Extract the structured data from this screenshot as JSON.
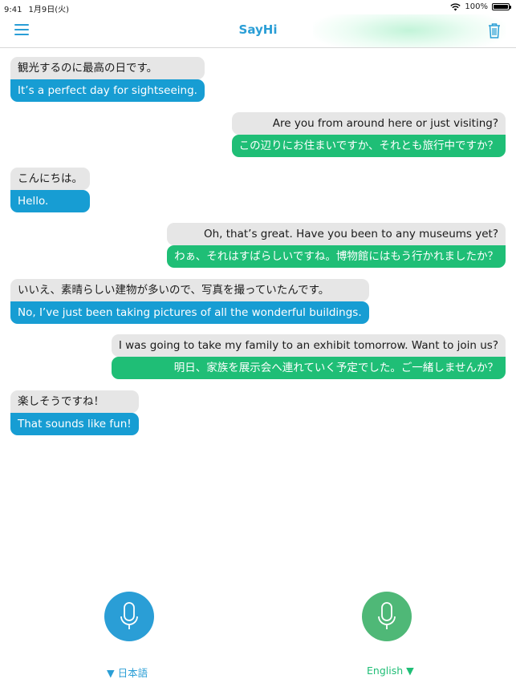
{
  "status_bar": {
    "time": "9:41",
    "date": "1月9日(火)",
    "battery": "100%"
  },
  "nav": {
    "title": "SayHi"
  },
  "messages": [
    {
      "side": "left",
      "original": "観光するのに最高の日です。",
      "translation": "It’s a perfect day for sightseeing."
    },
    {
      "side": "right",
      "original": "Are you from around here or just visiting?",
      "translation": "この辺りにお住まいですか、それとも旅行中ですか？"
    },
    {
      "side": "left",
      "original": "こんにちは。",
      "translation": "Hello."
    },
    {
      "side": "right",
      "original": "Oh, that’s great. Have you been to any museums yet?",
      "translation": "わぁ、それはすばらしいですね。博物館にはもう行かれましたか？"
    },
    {
      "side": "left",
      "original": "いいえ、素晴らしい建物が多いので、写真を撮っていたんです。",
      "translation": "No, I’ve just been taking pictures of all the wonderful buildings."
    },
    {
      "side": "right",
      "original": "I was going to take my family to an exhibit tomorrow. Want to join us?",
      "translation": "明日、家族を展示会へ連れていく予定でした。ご一緒しませんか？"
    },
    {
      "side": "left",
      "original": "楽しそうですね！",
      "translation": "That sounds like fun!"
    }
  ],
  "languages": {
    "left": "▼ 日本語",
    "right": "English ▼"
  },
  "colors": {
    "accent_blue": "#2a9ed6",
    "bubble_blue": "#179dd3",
    "bubble_green": "#1fbe76",
    "mic_green": "#4fb877",
    "bubble_gray": "#e6e6e6"
  },
  "icons": {
    "menu": "hamburger-menu-icon",
    "trash": "trash-icon",
    "mic": "microphone-icon",
    "wifi": "wifi-icon",
    "battery": "battery-icon"
  }
}
